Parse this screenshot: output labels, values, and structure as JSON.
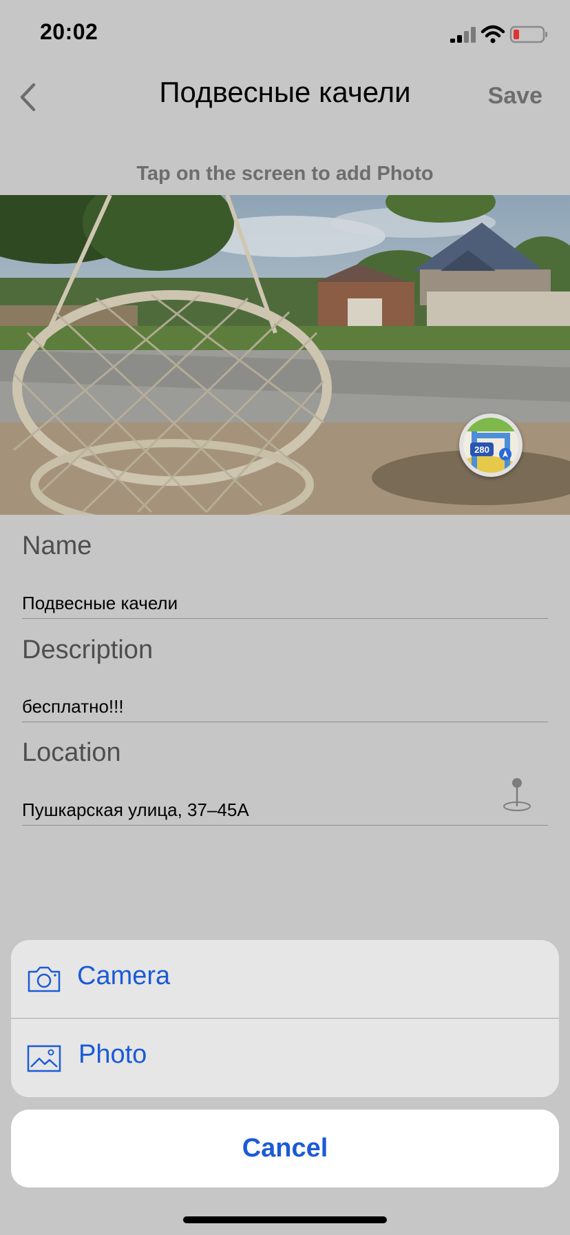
{
  "status": {
    "time": "20:02",
    "icons": [
      "signal-icon",
      "wifi-icon",
      "battery-low-icon"
    ]
  },
  "nav": {
    "back_icon": "chevron-left-icon",
    "title": "Подвесные качели",
    "save_label": "Save"
  },
  "hint": "Tap on the screen to add Photo",
  "photo": {
    "map_badge_number": "280"
  },
  "form": {
    "name_label": "Name",
    "name_value": "Подвесные качели",
    "description_label": "Description",
    "description_value": "бесплатно!!!",
    "location_label": "Location",
    "location_value": "Пушкарская улица, 37–45А",
    "location_icon": "map-pin-icon"
  },
  "sheet": {
    "camera_label": "Camera",
    "camera_icon": "camera-icon",
    "photo_label": "Photo",
    "photo_icon": "photo-icon",
    "cancel_label": "Cancel"
  },
  "colors": {
    "accent": "#1a5bd6",
    "dim_background": "#c6c6c6",
    "battery_low": "#e0322f"
  }
}
